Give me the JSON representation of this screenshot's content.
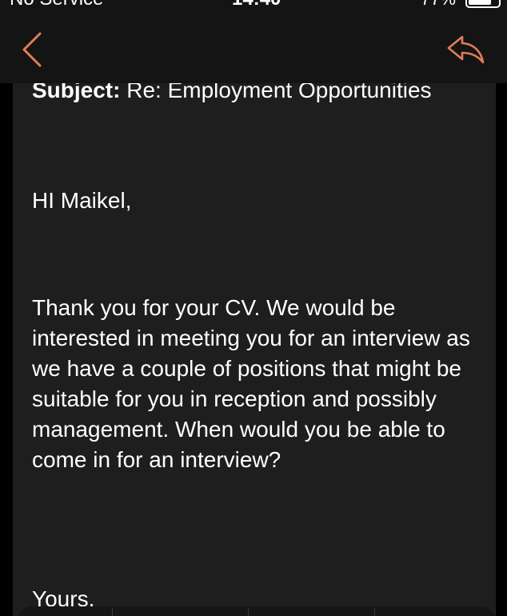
{
  "status_bar": {
    "carrier": "No Service",
    "time": "14:40",
    "battery_text": "77%",
    "battery_level": 0.77
  },
  "nav": {
    "back_icon": "chevron-left-icon",
    "reply_icon": "reply-arrow-icon",
    "accent_color": "#e07e57"
  },
  "message": {
    "subject_label": "Subject:",
    "subject_value": "Re: Employment Opportunities",
    "greeting": "HI Maikel,",
    "body": "Thank you for your CV. We would be interested in meeting you for an interview as we have a couple of positions that might be suitable for you in reception and possibly management. When would you be able to come in for an interview?",
    "signoff": "Yours,"
  }
}
